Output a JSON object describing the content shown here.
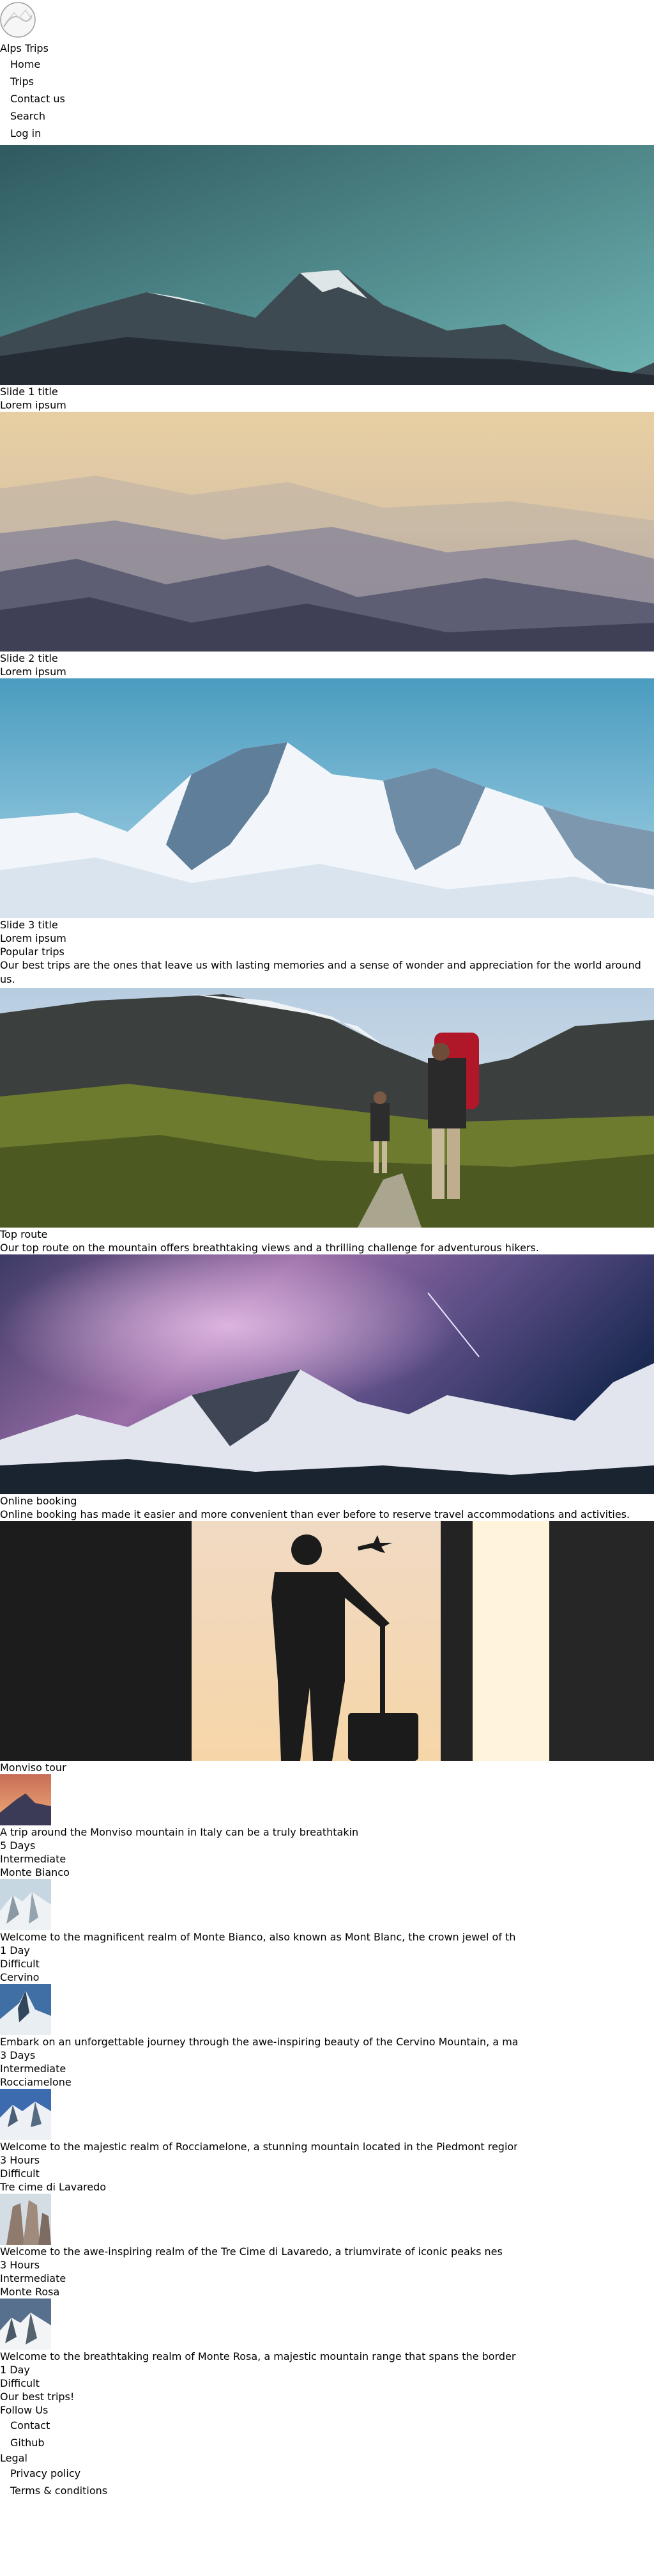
{
  "site": {
    "title": "Alps Trips"
  },
  "nav": [
    {
      "label": "Home"
    },
    {
      "label": "Trips"
    },
    {
      "label": "Contact us"
    },
    {
      "label": "Search"
    },
    {
      "label": "Log in"
    }
  ],
  "slides": [
    {
      "title": "Slide 1 title",
      "caption": "Lorem ipsum"
    },
    {
      "title": "Slide 2 title",
      "caption": "Lorem ipsum"
    },
    {
      "title": "Slide 3 title",
      "caption": "Lorem ipsum"
    }
  ],
  "popular": {
    "heading": "Popular trips",
    "text": "Our best trips are the ones that leave us with lasting memories and a sense of wonder and appreciation for the world around us."
  },
  "features": [
    {
      "title": "Top route",
      "text": "Our top route on the mountain offers breathtaking views and a thrilling challenge for adventurous hikers."
    },
    {
      "title": "Online booking",
      "text": "Online booking has made it easier and more convenient than ever before to reserve travel accommodations and activities."
    }
  ],
  "tours": [
    {
      "name": "Monviso tour",
      "desc": "A trip around the Monviso mountain in Italy can be a truly breathtakin",
      "duration": "5 Days",
      "level": "Intermediate"
    },
    {
      "name": "Monte Bianco",
      "desc": "Welcome to the magnificent realm of Monte Bianco, also known as Mont Blanc, the crown jewel of th",
      "duration": "1 Day",
      "level": "Difficult"
    },
    {
      "name": "Cervino",
      "desc": "Embark on an unforgettable journey through the awe-inspiring beauty of the Cervino Mountain, a ma",
      "duration": "3 Days",
      "level": "Intermediate"
    },
    {
      "name": "Rocciamelone",
      "desc": "Welcome to the majestic realm of Rocciamelone, a stunning mountain located in the Piedmont region",
      "duration": "3 Hours",
      "level": "Difficult"
    },
    {
      "name": "Tre cime di Lavaredo",
      "desc": "Welcome to the awe-inspiring realm of the Tre Cime di Lavaredo, a triumvirate of iconic peaks nes",
      "duration": "3 Hours",
      "level": "Intermediate"
    },
    {
      "name": "Monte Rosa",
      "desc": "Welcome to the breathtaking realm of Monte Rosa, a majestic mountain range that spans the border",
      "duration": "1 Day",
      "level": "Difficult"
    }
  ],
  "footer": {
    "tagline": "Our best trips!",
    "follow_heading": "Follow Us",
    "follow_links": [
      {
        "label": "Contact"
      },
      {
        "label": "Github"
      }
    ],
    "legal_heading": "Legal",
    "legal_links": [
      {
        "label": "Privacy policy"
      },
      {
        "label": "Terms & conditions"
      }
    ]
  }
}
